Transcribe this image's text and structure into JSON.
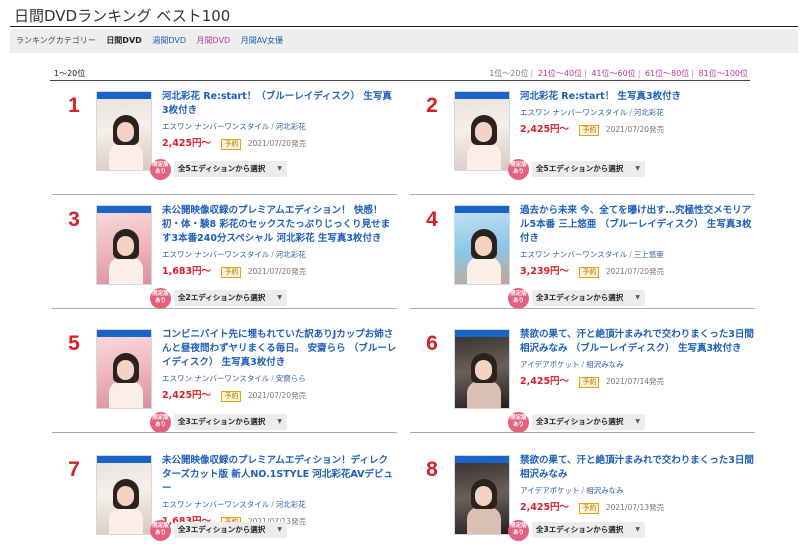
{
  "page": {
    "title": "日間DVDランキング ベスト100"
  },
  "categories": {
    "label": "ランキングカテゴリー",
    "items": [
      {
        "label": "日間DVD",
        "active": true
      },
      {
        "label": "週間DVD",
        "active": false
      },
      {
        "label": "月間DVD",
        "active": false
      },
      {
        "label": "月間AV女優",
        "active": false
      }
    ]
  },
  "range_label": "1〜20位",
  "pager": [
    "1位〜20位",
    "21位〜40位",
    "41位〜60位",
    "61位〜80位",
    "81位〜100位"
  ],
  "common": {
    "yoyaku": "予約",
    "ltd": "限定版あり",
    "select_suffix": "から選択"
  },
  "items": [
    {
      "rank": "1",
      "title": "河北彩花 Re:start！（ブルーレイディスク） 生写真3枚付き",
      "maker": "エスワン ナンバーワンスタイル",
      "actress": "河北彩花",
      "price": "2,425円〜",
      "date": "2021/07/20発売",
      "editions": "全5エディションから選択"
    },
    {
      "rank": "2",
      "title": "河北彩花 Re:start！ 生写真3枚付き",
      "maker": "エスワン ナンバーワンスタイル",
      "actress": "河北彩花",
      "price": "2,425円〜",
      "date": "2021/07/20発売",
      "editions": "全5エディションから選択"
    },
    {
      "rank": "3",
      "title": "未公開映像収録のプレミアムエディション！ 快感！初・体・験8 彩花のセックスたっぷりじっくり見せます3本番240分スペシャル 河北彩花 生写真3枚付き",
      "maker": "エスワン ナンバーワンスタイル",
      "actress": "河北彩花",
      "price": "1,683円〜",
      "date": "2021/07/20発売",
      "editions": "全2エディションから選択"
    },
    {
      "rank": "4",
      "title": "過去から未来 今、全てを曝け出す…究極性交メモリアル5本番 三上悠亜 （ブルーレイディスク） 生写真3枚付き",
      "maker": "エスワン ナンバーワンスタイル",
      "actress": "三上悠亜",
      "price": "3,239円〜",
      "date": "2021/07/20発売",
      "editions": "全3エディションから選択"
    },
    {
      "rank": "5",
      "title": "コンビニバイト先に埋もれていた訳ありJカップお姉さんと昼夜問わずヤリまくる毎日。 安齋らら （ブルーレイディスク） 生写真3枚付き",
      "maker": "エスワン ナンバーワンスタイル",
      "actress": "安齋らら",
      "price": "2,425円〜",
      "date": "2021/07/20発売",
      "editions": "全3エディションから選択"
    },
    {
      "rank": "6",
      "title": "禁欲の果て、汗と絶頂汁まみれで交わりまくった3日間 相沢みなみ （ブルーレイディスク） 生写真3枚付き",
      "maker": "アイデアポケット",
      "actress": "相沢みなみ",
      "price": "2,425円〜",
      "date": "2021/07/14発売",
      "editions": "全3エディションから選択"
    },
    {
      "rank": "7",
      "title": "未公開映像収録のプレミアムエディション！ディレクターズカット版 新人NO.1STYLE 河北彩花AVデビュー",
      "maker": "エスワン ナンバーワンスタイル",
      "actress": "河北彩花",
      "price": "1,683円〜",
      "date": "2021/07/13発売",
      "editions": "全3エディションから選択"
    },
    {
      "rank": "8",
      "title": "禁欲の果て、汗と絶頂汁まみれで交わりまくった3日間 相沢みなみ",
      "maker": "アイデアポケット",
      "actress": "相沢みなみ",
      "price": "2,425円〜",
      "date": "2021/07/13発売",
      "editions": "全3エディションから選択"
    }
  ]
}
